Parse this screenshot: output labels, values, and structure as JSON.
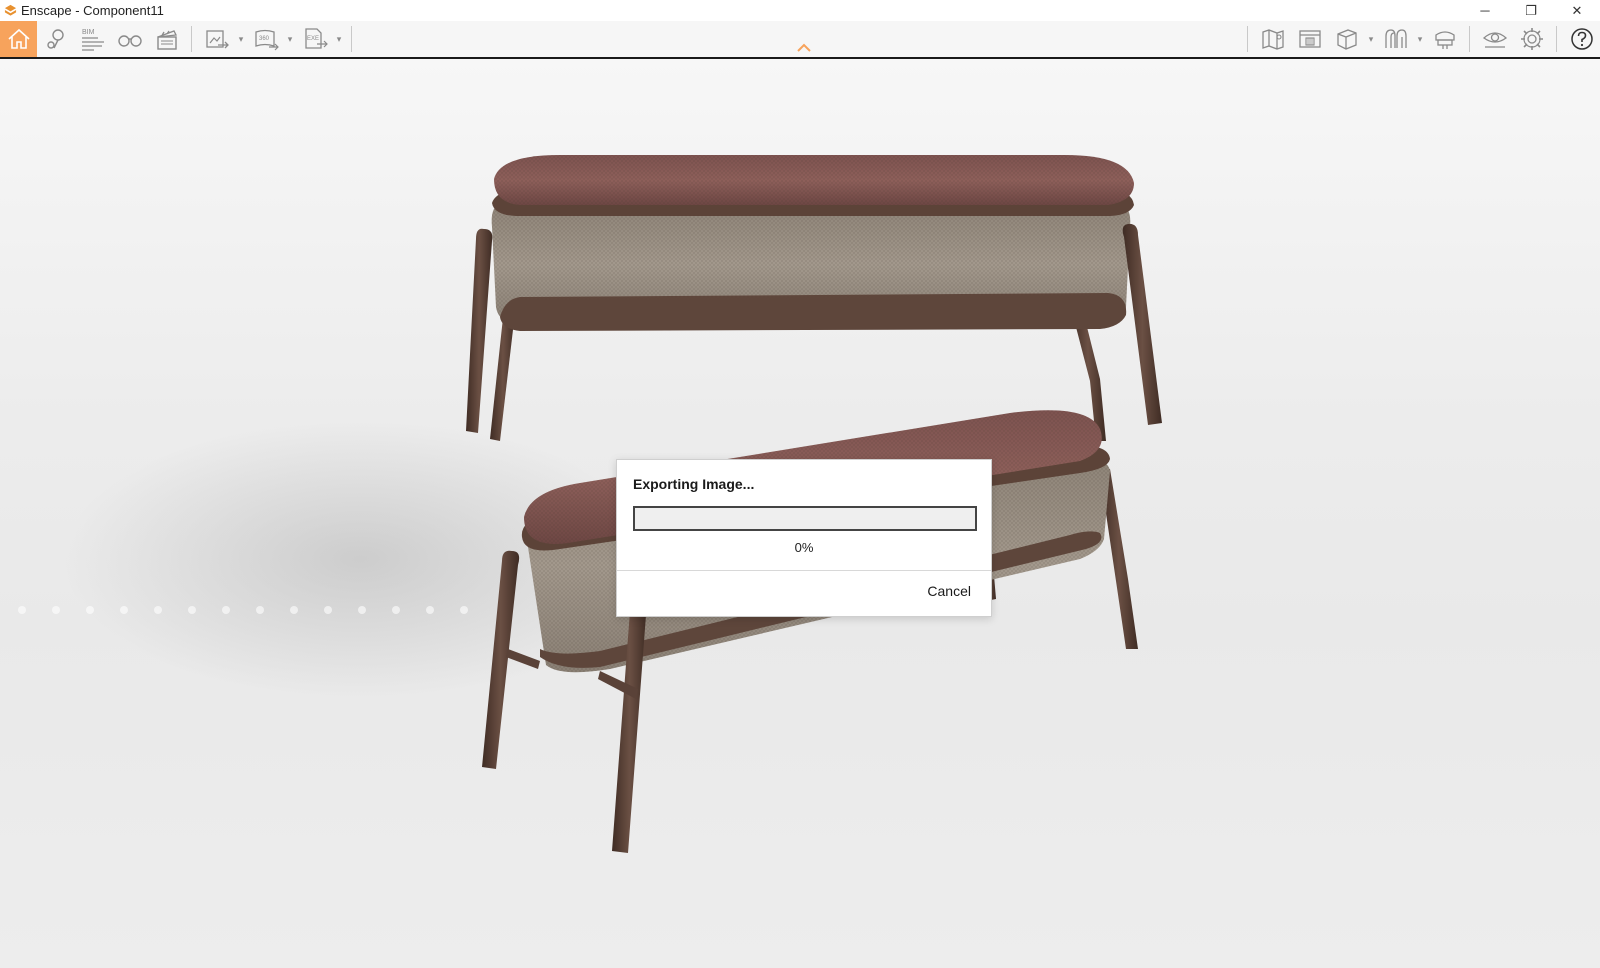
{
  "window": {
    "title": "Enscape - Component11",
    "controls": {
      "minimize": "─",
      "restore": "❐",
      "close": "✕"
    }
  },
  "toolbar": {
    "left_items": [
      {
        "name": "home",
        "icon": "home-icon",
        "active": true
      },
      {
        "name": "views",
        "icon": "location-pin-icon"
      },
      {
        "name": "bim",
        "icon": "bim-icon",
        "label": "BIM"
      },
      {
        "name": "binoculars",
        "icon": "binoculars-icon"
      },
      {
        "name": "video-editor",
        "icon": "clapperboard-icon"
      },
      {
        "name": "screenshot-export",
        "icon": "image-export-icon",
        "dropdown": true
      },
      {
        "name": "panorama-export",
        "icon": "panorama-360-icon",
        "label": "360",
        "dropdown": true
      },
      {
        "name": "exe-export",
        "icon": "exe-export-icon",
        "label": "EXE",
        "dropdown": true
      }
    ],
    "right_items": [
      {
        "name": "map",
        "icon": "map-icon"
      },
      {
        "name": "site-context",
        "icon": "building-icon"
      },
      {
        "name": "materials",
        "icon": "cube-icon",
        "dropdown": true
      },
      {
        "name": "atmosphere",
        "icon": "atmosphere-icon",
        "dropdown": true
      },
      {
        "name": "vr",
        "icon": "vr-headset-icon"
      },
      {
        "name": "visual-settings",
        "icon": "eye-icon"
      },
      {
        "name": "settings",
        "icon": "gear-icon"
      },
      {
        "name": "help",
        "icon": "help-icon"
      }
    ],
    "accent_color": "#f7a35c"
  },
  "dialog": {
    "title": "Exporting Image...",
    "progress_fraction": 0,
    "progress_text": "0%",
    "cancel_label": "Cancel"
  },
  "colors": {
    "cushion": "#8a5a56",
    "wood": "#5a4238",
    "fabric": "#9b9186"
  }
}
